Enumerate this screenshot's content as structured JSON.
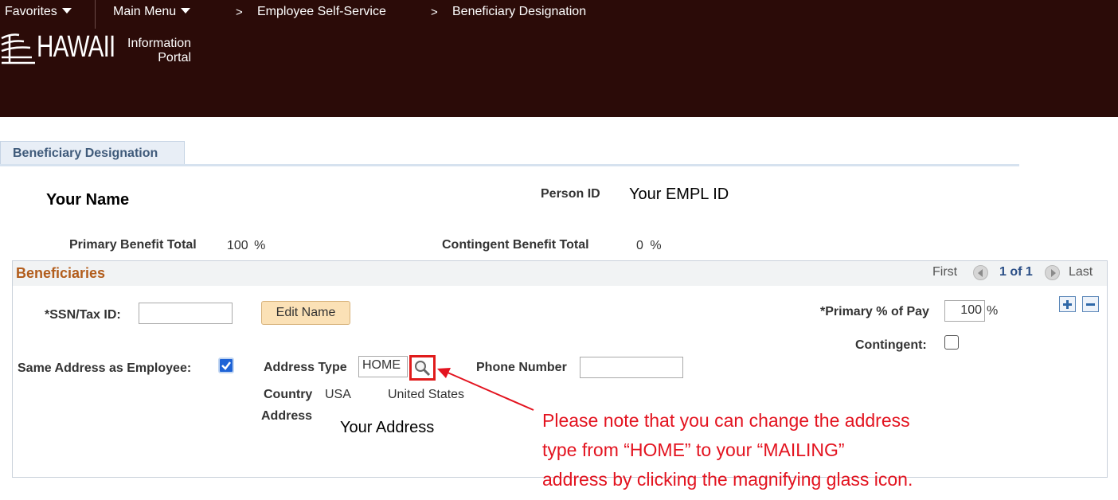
{
  "header": {
    "nav": {
      "favorites": "Favorites",
      "main_menu": "Main Menu",
      "sep": ">",
      "crumb1": "Employee Self-Service",
      "crumb2": "Beneficiary Designation"
    },
    "logo": {
      "name": "HAWAII",
      "info_line1": "Information",
      "info_line2": "Portal"
    }
  },
  "tab": {
    "label": "Beneficiary Designation"
  },
  "summary": {
    "your_name": "Your Name",
    "person_id_label": "Person ID",
    "person_id_value": "Your EMPL ID",
    "primary_total_label": "Primary Benefit Total",
    "primary_total_value": "100",
    "primary_total_unit": "%",
    "contingent_total_label": "Contingent Benefit Total",
    "contingent_total_value": "0",
    "contingent_total_unit": "%"
  },
  "beneficiaries": {
    "title": "Beneficiaries",
    "pager": {
      "first": "First",
      "count": "1 of 1",
      "last": "Last"
    },
    "ssn_label": "*SSN/Tax ID:",
    "ssn_value": "",
    "edit_name": "Edit Name",
    "primary_pct_label": "*Primary % of Pay",
    "primary_pct_value": "100",
    "primary_pct_unit": "%",
    "contingent_label": "Contingent:",
    "same_address_label": "Same Address as Employee:",
    "same_address_checked": true,
    "address_type_label": "Address Type",
    "address_type_value": "HOME",
    "phone_label": "Phone Number",
    "phone_value": "",
    "country_label": "Country",
    "country_code": "USA",
    "country_name": "United States",
    "address_label": "Address",
    "address_value": "Your Address"
  },
  "annotation": {
    "line1": "Please note that you can change the address",
    "line2": "type from “HOME” to your “MAILING”",
    "line3": "address by clicking the magnifying glass icon.",
    "color": "#e3131f"
  },
  "colors": {
    "header_bg": "#2b0b08",
    "panel_title": "#b25d1c",
    "tab_text": "#3f5a7a",
    "button_bg": "#fbe1b6"
  }
}
